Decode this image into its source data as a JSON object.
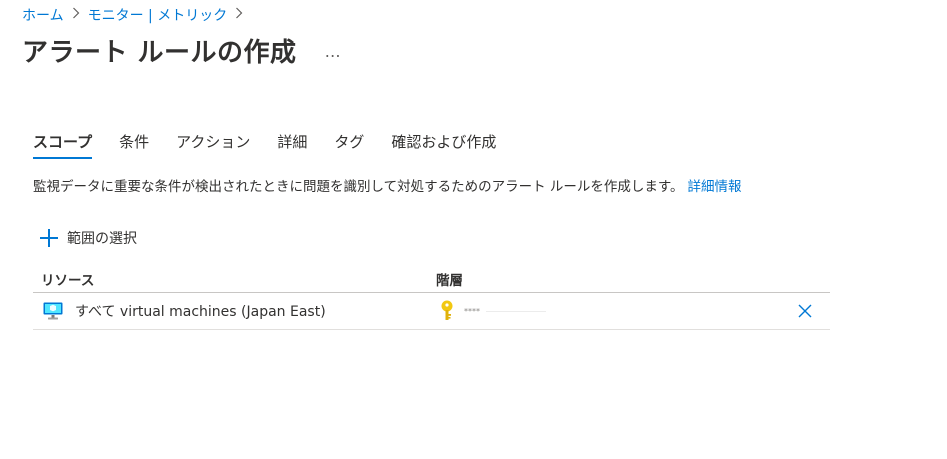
{
  "breadcrumb": {
    "home": "ホーム",
    "monitor": "モニター | メトリック"
  },
  "header": {
    "title": "アラート ルールの作成",
    "more": "…"
  },
  "tabs": [
    {
      "label": "スコープ",
      "active": true
    },
    {
      "label": "条件",
      "active": false
    },
    {
      "label": "アクション",
      "active": false
    },
    {
      "label": "詳細",
      "active": false
    },
    {
      "label": "タグ",
      "active": false
    },
    {
      "label": "確認および作成",
      "active": false
    }
  ],
  "description": {
    "text": "監視データに重要な条件が検出されたときに問題を識別して対処するためのアラート ルールを作成します。",
    "link": "詳細情報"
  },
  "select_scope": {
    "label": "範囲の選択"
  },
  "table": {
    "columns": {
      "resource": "リソース",
      "hierarchy": "階層"
    },
    "rows": [
      {
        "resource": "すべて virtual machines (Japan East)",
        "hierarchy": "****"
      }
    ]
  },
  "colors": {
    "accent": "#0078d4",
    "text": "#323130",
    "key_icon": "#f2c811"
  },
  "icons": {
    "breadcrumb_separator": "chevron-right-icon",
    "more": "more-icon",
    "add": "plus-icon",
    "vm": "virtual-machine-icon",
    "subscription": "key-icon",
    "remove": "close-icon"
  }
}
